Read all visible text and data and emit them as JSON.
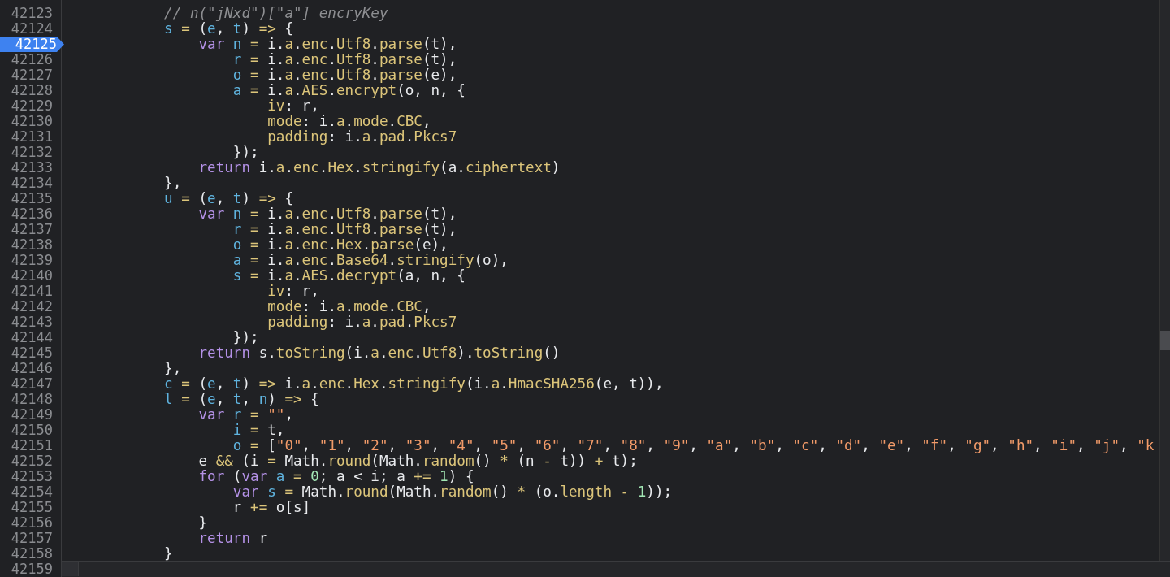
{
  "lines": [
    {
      "number": "42123",
      "breakpoint": false,
      "code": "            // n(\"jNxd\")[\"a\"] encryKey"
    },
    {
      "number": "42124",
      "breakpoint": false,
      "code": "            s = (e, t) => {"
    },
    {
      "number": "42125",
      "breakpoint": true,
      "code": "                var n = i.a.enc.Utf8.parse(t),"
    },
    {
      "number": "42126",
      "breakpoint": false,
      "code": "                    r = i.a.enc.Utf8.parse(t),"
    },
    {
      "number": "42127",
      "breakpoint": false,
      "code": "                    o = i.a.enc.Utf8.parse(e),"
    },
    {
      "number": "42128",
      "breakpoint": false,
      "code": "                    a = i.a.AES.encrypt(o, n, {"
    },
    {
      "number": "42129",
      "breakpoint": false,
      "code": "                        iv: r,"
    },
    {
      "number": "42130",
      "breakpoint": false,
      "code": "                        mode: i.a.mode.CBC,"
    },
    {
      "number": "42131",
      "breakpoint": false,
      "code": "                        padding: i.a.pad.Pkcs7"
    },
    {
      "number": "42132",
      "breakpoint": false,
      "code": "                    });"
    },
    {
      "number": "42133",
      "breakpoint": false,
      "code": "                return i.a.enc.Hex.stringify(a.ciphertext)"
    },
    {
      "number": "42134",
      "breakpoint": false,
      "code": "            },"
    },
    {
      "number": "42135",
      "breakpoint": false,
      "code": "            u = (e, t) => {"
    },
    {
      "number": "42136",
      "breakpoint": false,
      "code": "                var n = i.a.enc.Utf8.parse(t),"
    },
    {
      "number": "42137",
      "breakpoint": false,
      "code": "                    r = i.a.enc.Utf8.parse(t),"
    },
    {
      "number": "42138",
      "breakpoint": false,
      "code": "                    o = i.a.enc.Hex.parse(e),"
    },
    {
      "number": "42139",
      "breakpoint": false,
      "code": "                    a = i.a.enc.Base64.stringify(o),"
    },
    {
      "number": "42140",
      "breakpoint": false,
      "code": "                    s = i.a.AES.decrypt(a, n, {"
    },
    {
      "number": "42141",
      "breakpoint": false,
      "code": "                        iv: r,"
    },
    {
      "number": "42142",
      "breakpoint": false,
      "code": "                        mode: i.a.mode.CBC,"
    },
    {
      "number": "42143",
      "breakpoint": false,
      "code": "                        padding: i.a.pad.Pkcs7"
    },
    {
      "number": "42144",
      "breakpoint": false,
      "code": "                    });"
    },
    {
      "number": "42145",
      "breakpoint": false,
      "code": "                return s.toString(i.a.enc.Utf8).toString()"
    },
    {
      "number": "42146",
      "breakpoint": false,
      "code": "            },"
    },
    {
      "number": "42147",
      "breakpoint": false,
      "code": "            c = (e, t) => i.a.enc.Hex.stringify(i.a.HmacSHA256(e, t)),"
    },
    {
      "number": "42148",
      "breakpoint": false,
      "code": "            l = (e, t, n) => {"
    },
    {
      "number": "42149",
      "breakpoint": false,
      "code": "                var r = \"\","
    },
    {
      "number": "42150",
      "breakpoint": false,
      "code": "                    i = t,"
    },
    {
      "number": "42151",
      "breakpoint": false,
      "code": "                    o = [\"0\", \"1\", \"2\", \"3\", \"4\", \"5\", \"6\", \"7\", \"8\", \"9\", \"a\", \"b\", \"c\", \"d\", \"e\", \"f\", \"g\", \"h\", \"i\", \"j\", \"k"
    },
    {
      "number": "42152",
      "breakpoint": false,
      "code": "                e && (i = Math.round(Math.random() * (n - t)) + t);"
    },
    {
      "number": "42153",
      "breakpoint": false,
      "code": "                for (var a = 0; a < i; a += 1) {"
    },
    {
      "number": "42154",
      "breakpoint": false,
      "code": "                    var s = Math.round(Math.random() * (o.length - 1));"
    },
    {
      "number": "42155",
      "breakpoint": false,
      "code": "                    r += o[s]"
    },
    {
      "number": "42156",
      "breakpoint": false,
      "code": "                }"
    },
    {
      "number": "42157",
      "breakpoint": false,
      "code": "                return r"
    },
    {
      "number": "42158",
      "breakpoint": false,
      "code": "            }"
    },
    {
      "number": "42159",
      "breakpoint": false
    }
  ]
}
